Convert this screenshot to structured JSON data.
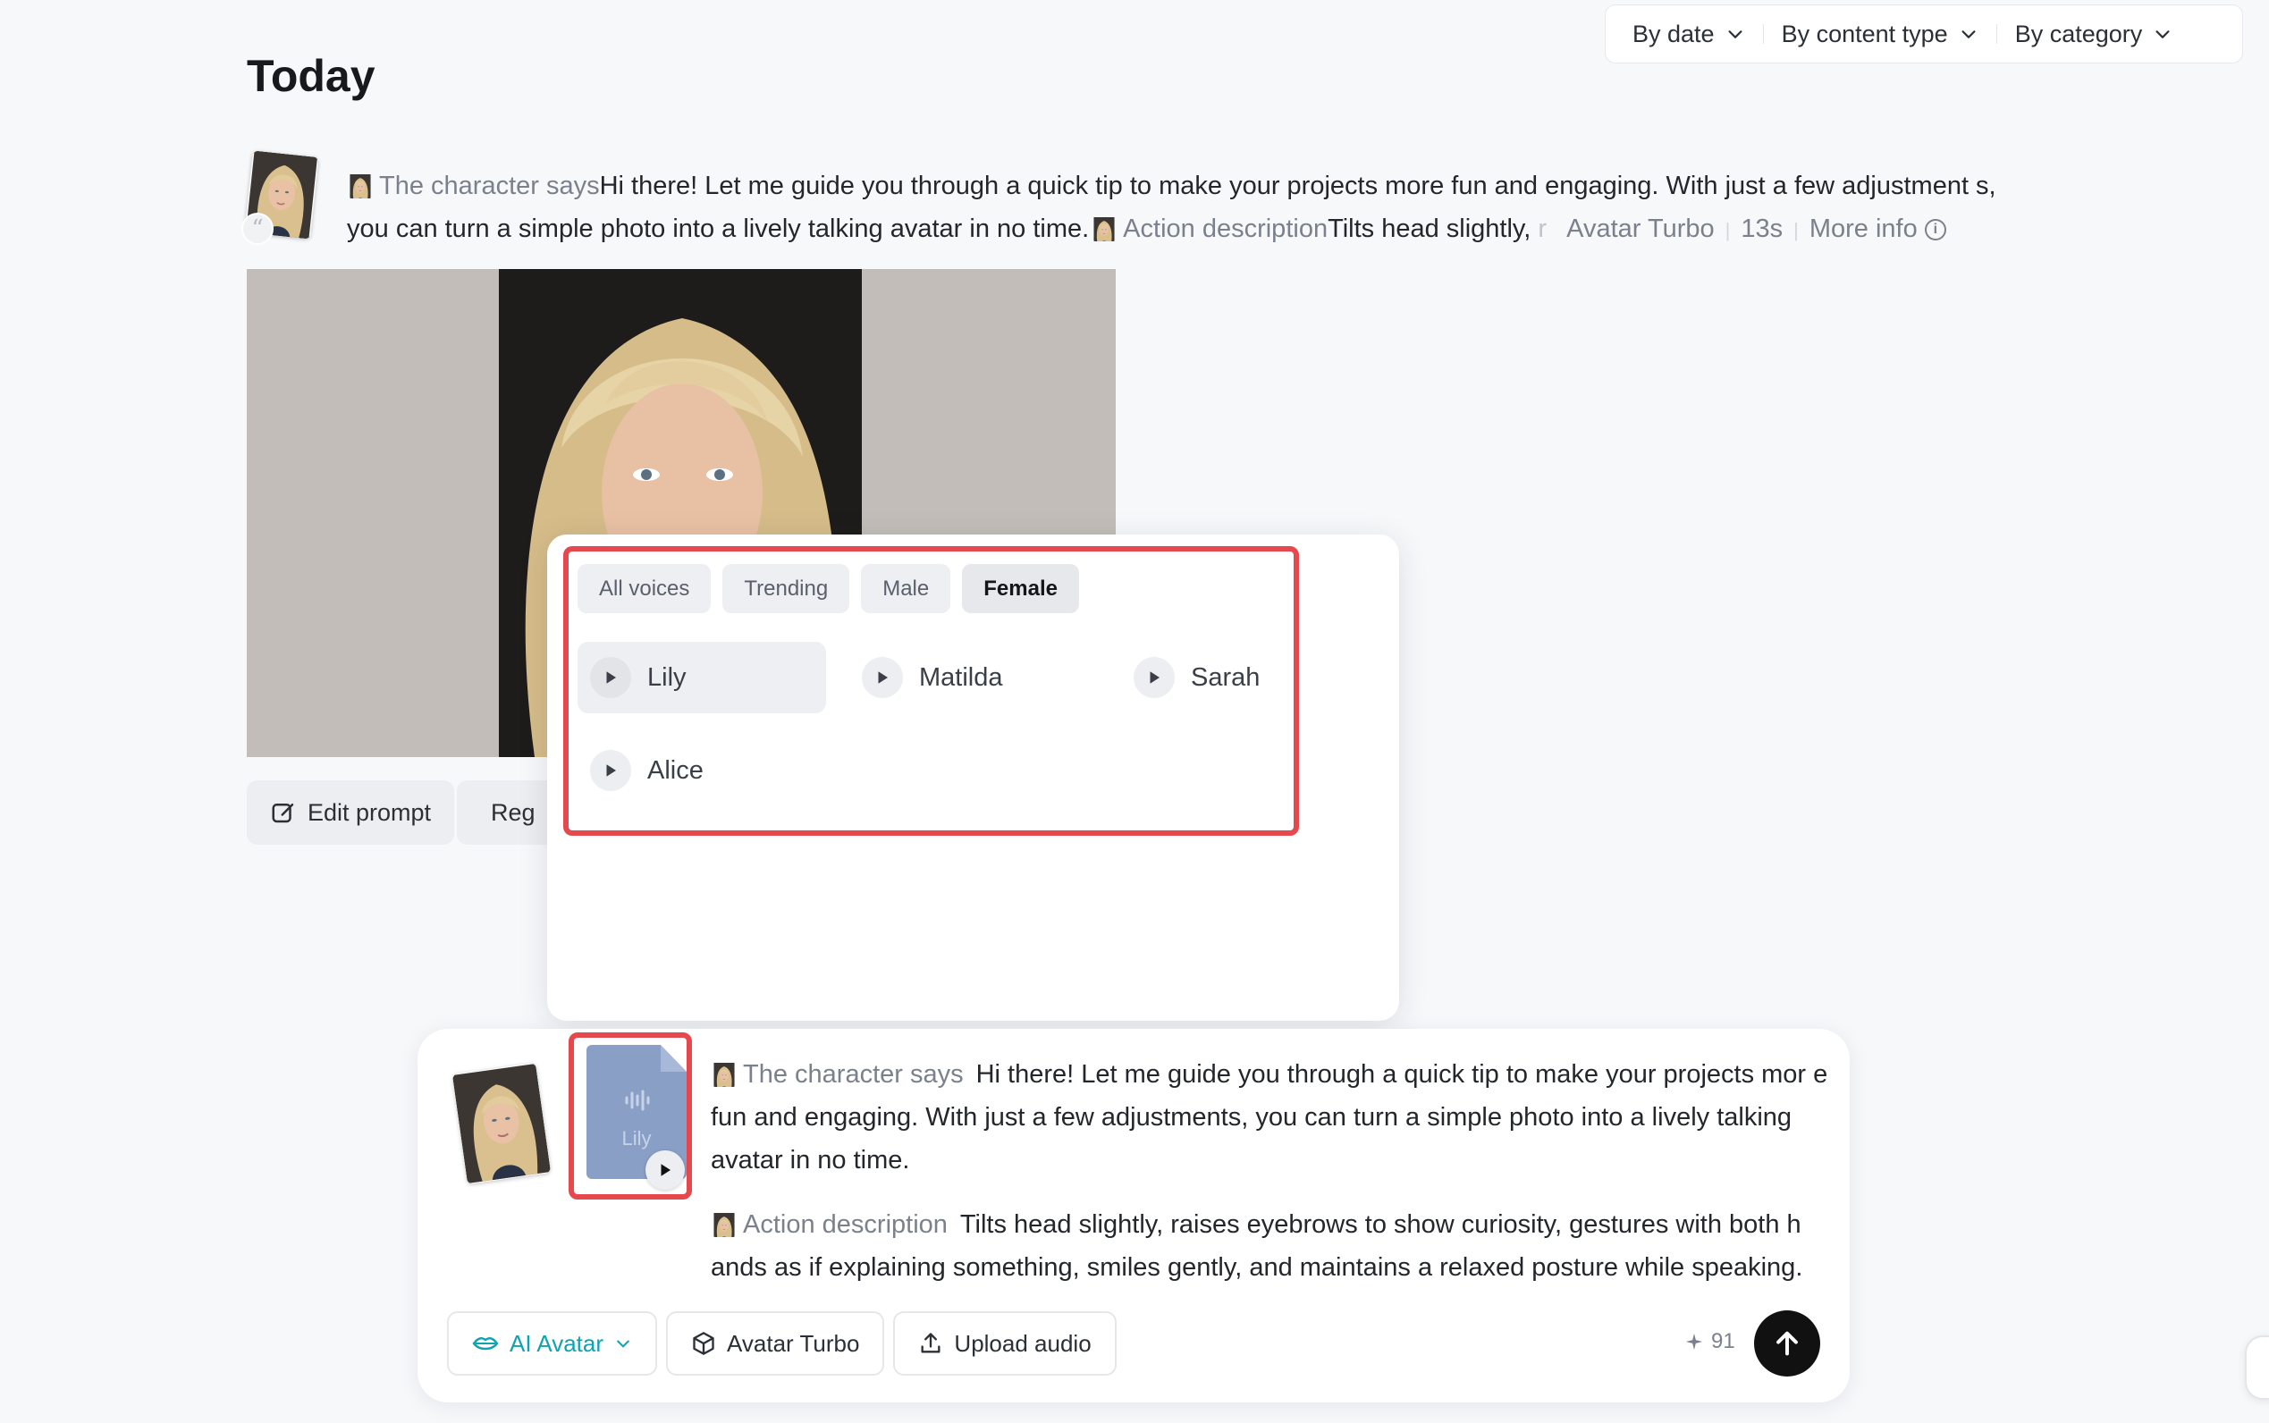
{
  "filters": [
    {
      "label": "By date"
    },
    {
      "label": "By content type"
    },
    {
      "label": "By category"
    }
  ],
  "page_title": "Today",
  "entry": {
    "character_says_label": "The character says",
    "character_says_text": "Hi there! Let me guide you through a quick tip to make your projects more fun and engaging. With just a few adjustment s, you can turn a simple photo into a lively talking avatar in no time.",
    "action_label": "Action description",
    "action_text": "Tilts head slightly,",
    "action_fade": "r",
    "model": "Avatar Turbo",
    "duration": "13s",
    "more_info": "More info",
    "quote_glyph": "“"
  },
  "actions": {
    "edit_prompt": "Edit prompt",
    "regenerate": "Reg"
  },
  "voice_picker": {
    "tabs": [
      "All voices",
      "Trending",
      "Male",
      "Female"
    ],
    "active_tab": "Female",
    "voices": [
      {
        "name": "Lily",
        "selected": true
      },
      {
        "name": "Matilda",
        "selected": false
      },
      {
        "name": "Sarah",
        "selected": false
      },
      {
        "name": "Alice",
        "selected": false
      }
    ]
  },
  "composer": {
    "audio_card_label": "Lily",
    "character_says_label": "The character says",
    "character_says_text": "Hi there! Let me guide you through a quick tip to make your projects mor e fun and engaging. With just a few adjustments, you can turn a simple photo into a lively talking avatar in no time.",
    "action_label": "Action description",
    "action_text": "Tilts head slightly, raises eyebrows to show curiosity, gestures with both h ands as if explaining something, smiles gently, and maintains a relaxed posture while speaking.",
    "mode": "AI Avatar",
    "model": "Avatar Turbo",
    "upload": "Upload audio",
    "credits": "91",
    "accent_color": "#0fa3b1",
    "highlight_color": "#e5484d"
  }
}
